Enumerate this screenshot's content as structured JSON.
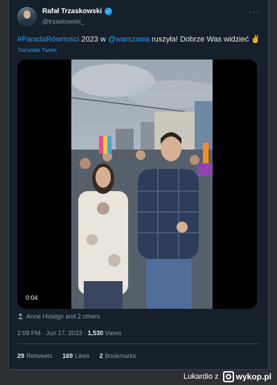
{
  "tweet": {
    "author_name": "Rafał Trzaskowski",
    "author_handle": "@trzaskowski_",
    "text_hashtag": "#ParadaRówności",
    "text_year": " 2023 w ",
    "text_mention": "@warszawa",
    "text_rest": " ruszyła! Dobrze Was widzieć ✌",
    "translate_label": "Translate Tweet",
    "more_icon": "more-dots-icon"
  },
  "media": {
    "duration": "0:04"
  },
  "tagged": {
    "text": "Anne Hidalgo and 2 others",
    "icon": "person-icon"
  },
  "meta": {
    "time": "2:09 PM",
    "separator": " · ",
    "date": "Jun 17, 2023",
    "views_count": "1,530",
    "views_label": " Views"
  },
  "stats": {
    "retweets_count": "29",
    "retweets_label": "Retweets",
    "likes_count": "169",
    "likes_label": "Likes",
    "bookmarks_count": "2",
    "bookmarks_label": "Bookmarks"
  },
  "watermark": {
    "prefix": "Lukardio z",
    "logo_text": "wykop.pl"
  },
  "colors": {
    "background": "#15202b",
    "accent": "#1d9bf0",
    "text": "#e7e9ea",
    "muted": "#8b98a5"
  }
}
